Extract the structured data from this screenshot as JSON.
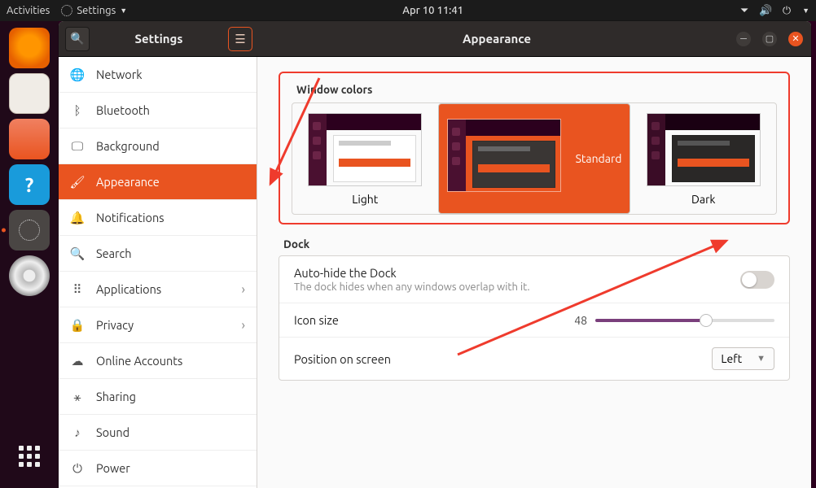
{
  "topbar": {
    "activities": "Activities",
    "appname": "Settings",
    "datetime": "Apr 10  11:41"
  },
  "dock_apps": [
    {
      "name": "firefox",
      "cls": "ff"
    },
    {
      "name": "files",
      "cls": "fm"
    },
    {
      "name": "software",
      "cls": "sc"
    },
    {
      "name": "help",
      "cls": "hp",
      "glyph": "?"
    },
    {
      "name": "settings",
      "cls": "gr",
      "active": true
    },
    {
      "name": "disc",
      "cls": "cd"
    }
  ],
  "window": {
    "sidebar_title": "Settings",
    "title": "Appearance"
  },
  "sidebar": [
    {
      "icon": "🌐",
      "label": "Network",
      "name": "network"
    },
    {
      "icon": "ᛒ",
      "label": "Bluetooth",
      "name": "bluetooth"
    },
    {
      "icon": "🖵",
      "label": "Background",
      "name": "background"
    },
    {
      "icon": "🖌",
      "label": "Appearance",
      "name": "appearance",
      "selected": true
    },
    {
      "icon": "🔔",
      "label": "Notifications",
      "name": "notifications"
    },
    {
      "icon": "🔍",
      "label": "Search",
      "name": "search"
    },
    {
      "icon": "⠿",
      "label": "Applications",
      "name": "applications",
      "chevron": true
    },
    {
      "icon": "🔒",
      "label": "Privacy",
      "name": "privacy",
      "chevron": true
    },
    {
      "icon": "☁",
      "label": "Online Accounts",
      "name": "online-accounts"
    },
    {
      "icon": "⚹",
      "label": "Sharing",
      "name": "sharing"
    },
    {
      "icon": "♪",
      "label": "Sound",
      "name": "sound"
    },
    {
      "icon": "⏻",
      "label": "Power",
      "name": "power"
    }
  ],
  "appearance": {
    "section": "Window colors",
    "themes": [
      {
        "label": "Light",
        "cls": "light"
      },
      {
        "label": "Standard",
        "cls": "std",
        "selected": true
      },
      {
        "label": "Dark",
        "cls": "dark"
      }
    ]
  },
  "dock": {
    "section": "Dock",
    "autohide_title": "Auto-hide the Dock",
    "autohide_desc": "The dock hides when any windows overlap with it.",
    "autohide_on": false,
    "iconsize_label": "Icon size",
    "iconsize_value": "48",
    "position_label": "Position on screen",
    "position_value": "Left"
  }
}
